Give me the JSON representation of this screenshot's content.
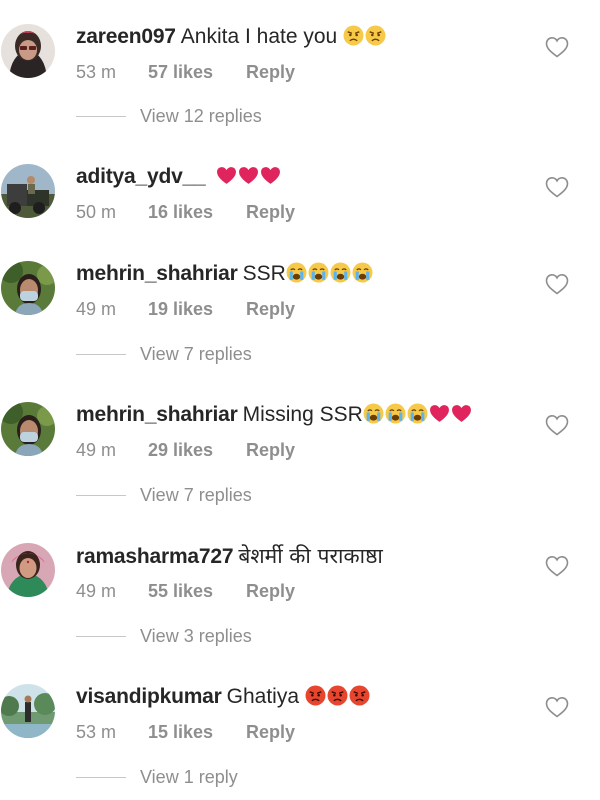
{
  "comments": [
    {
      "username": "zareen097",
      "text": "Ankita I hate you",
      "emojis": [
        "angry-face",
        "angry-face"
      ],
      "time": "53 m",
      "likes": "57 likes",
      "reply_label": "Reply",
      "view_replies": "View 12 replies"
    },
    {
      "username": "aditya_ydv__",
      "text": "",
      "emojis": [
        "red-heart",
        "red-heart",
        "red-heart"
      ],
      "time": "50 m",
      "likes": "16 likes",
      "reply_label": "Reply",
      "view_replies": ""
    },
    {
      "username": "mehrin_shahriar",
      "text": "SSR",
      "emojis": [
        "crying-face",
        "crying-face",
        "crying-face",
        "crying-face"
      ],
      "time": "49 m",
      "likes": "19 likes",
      "reply_label": "Reply",
      "view_replies": "View 7 replies"
    },
    {
      "username": "mehrin_shahriar",
      "text": "Missing SSR",
      "emojis": [
        "crying-face",
        "crying-face",
        "crying-face",
        "red-heart",
        "red-heart"
      ],
      "time": "49 m",
      "likes": "29 likes",
      "reply_label": "Reply",
      "view_replies": "View 7 replies"
    },
    {
      "username": "ramasharma727",
      "text": "बेशर्मी की पराकाष्ठा",
      "emojis": [],
      "time": "49 m",
      "likes": "55 likes",
      "reply_label": "Reply",
      "view_replies": "View 3 replies"
    },
    {
      "username": "visandipkumar",
      "text": "Ghatiya",
      "emojis": [
        "pouting-face",
        "pouting-face",
        "pouting-face"
      ],
      "time": "53 m",
      "likes": "15 likes",
      "reply_label": "Reply",
      "view_replies": "View 1 reply"
    }
  ],
  "icons": {
    "like": "heart-outline-icon"
  },
  "colors": {
    "text_primary": "#262626",
    "text_secondary": "#8e8e8e",
    "heart_red": "#e0245e"
  }
}
